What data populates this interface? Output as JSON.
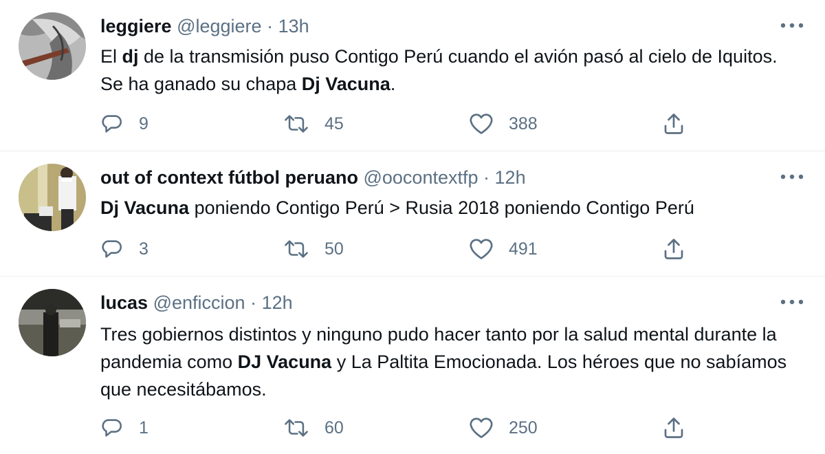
{
  "colors": {
    "text": "#0f1419",
    "secondary": "#5b7083",
    "divider": "#ebeef0",
    "background": "#ffffff"
  },
  "tweets": [
    {
      "name": "leggiere",
      "handle": "@leggiere",
      "separator": "·",
      "time": "13h",
      "text_parts": [
        "El ",
        "dj",
        " de la transmisión puso Contigo Perú cuando el avión pasó al cielo de Iquitos. Se ha ganado su chapa ",
        "Dj Vacuna",
        "."
      ],
      "replies": "9",
      "retweets": "45",
      "likes": "388"
    },
    {
      "name": "out of context fútbol peruano",
      "handle": "@oocontextfp",
      "separator": "·",
      "time": "12h",
      "text_parts": [
        "Dj Vacuna",
        " poniendo Contigo Perú > Rusia 2018 poniendo Contigo Perú"
      ],
      "replies": "3",
      "retweets": "50",
      "likes": "491"
    },
    {
      "name": "lucas",
      "handle": "@enficcion",
      "separator": "·",
      "time": "12h",
      "text_parts": [
        "Tres gobiernos distintos y ninguno pudo hacer tanto por la salud mental durante la pandemia como ",
        "DJ Vacuna",
        " y La Paltita Emocionada. Los héroes que no sabíamos que necesitábamos."
      ],
      "replies": "1",
      "retweets": "60",
      "likes": "250"
    }
  ],
  "icons": {
    "more": "more-horizontal-icon",
    "reply": "reply-bubble-icon",
    "retweet": "retweet-arrows-icon",
    "like": "heart-icon",
    "share": "share-upload-icon"
  }
}
